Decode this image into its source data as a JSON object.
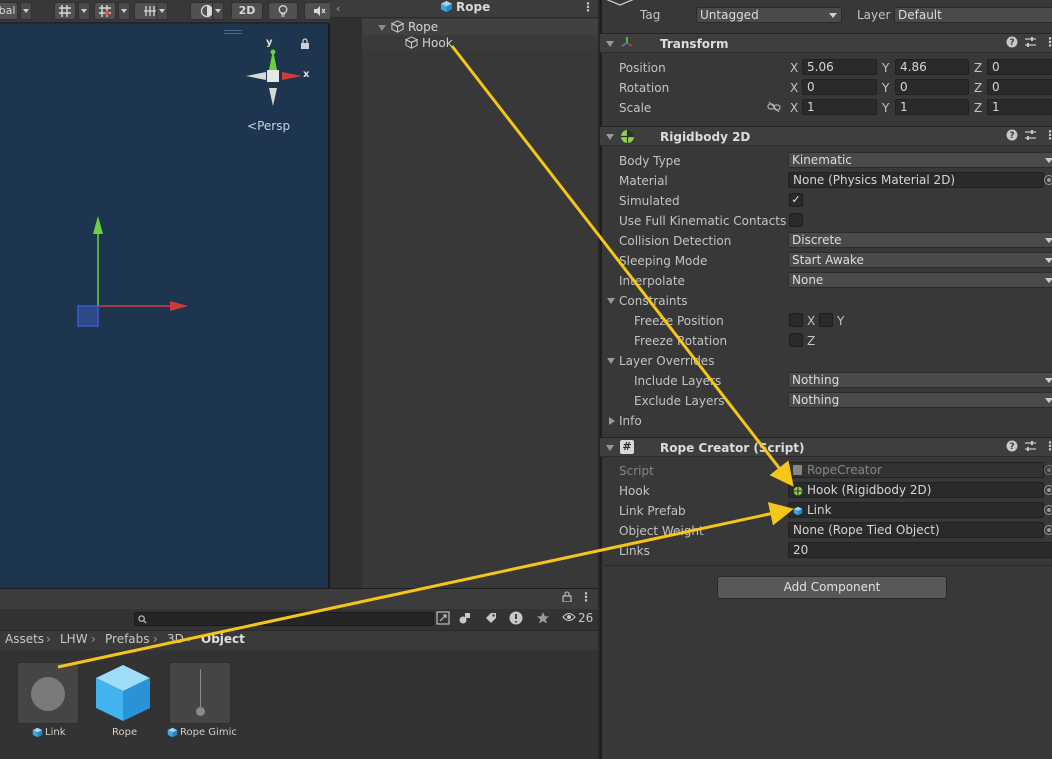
{
  "scene": {
    "toolbar": {
      "global_label": "bal",
      "mode_2d_label": "2D"
    },
    "gizmo": {
      "y_label": "y",
      "x_label": "x",
      "projection_label": "Persp"
    }
  },
  "hierarchy": {
    "title": "Rope",
    "items": [
      {
        "label": "Rope"
      },
      {
        "label": "Hook"
      }
    ]
  },
  "project": {
    "hidden_count": "26",
    "breadcrumb": [
      "Assets",
      "LHW",
      "Prefabs",
      "3D",
      "Object"
    ],
    "assets": [
      {
        "label": "Link"
      },
      {
        "label": "Rope"
      },
      {
        "label": "Rope Gimic"
      }
    ]
  },
  "inspector": {
    "tag_label": "Tag",
    "tag_value": "Untagged",
    "layer_label": "Layer",
    "layer_value": "Default",
    "transform": {
      "title": "Transform",
      "position_label": "Position",
      "rotation_label": "Rotation",
      "scale_label": "Scale",
      "position": {
        "x": "5.06",
        "y": "4.86",
        "z": "0"
      },
      "rotation": {
        "x": "0",
        "y": "0",
        "z": "0"
      },
      "scale": {
        "x": "1",
        "y": "1",
        "z": "1"
      }
    },
    "rigidbody": {
      "title": "Rigidbody 2D",
      "body_type_label": "Body Type",
      "body_type": "Kinematic",
      "material_label": "Material",
      "material": "None (Physics Material 2D)",
      "simulated_label": "Simulated",
      "simulated": "✓",
      "full_kinematic_label": "Use Full Kinematic Contacts",
      "collision_label": "Collision Detection",
      "collision": "Discrete",
      "sleeping_label": "Sleeping Mode",
      "sleeping": "Start Awake",
      "interpolate_label": "Interpolate",
      "interpolate": "None",
      "constraints_label": "Constraints",
      "freeze_position_label": "Freeze Position",
      "freeze_rotation_label": "Freeze Rotation",
      "axis_x": "X",
      "axis_y": "Y",
      "axis_z": "Z",
      "layer_overrides_label": "Layer Overrides",
      "include_layers_label": "Include Layers",
      "include_layers": "Nothing",
      "exclude_layers_label": "Exclude Layers",
      "exclude_layers": "Nothing",
      "info_label": "Info"
    },
    "rope_creator": {
      "title": "Rope Creator (Script)",
      "script_label": "Script",
      "script_value": "RopeCreator",
      "hook_label": "Hook",
      "hook_value": "Hook (Rigidbody 2D)",
      "link_prefab_label": "Link Prefab",
      "link_prefab_value": "Link",
      "object_weight_label": "Object Weight",
      "object_weight_value": "None (Rope Tied Object)",
      "links_label": "Links",
      "links_value": "20"
    },
    "add_component_label": "Add Component"
  },
  "colors": {
    "scene_bg": "#1e3550",
    "annotation_arrow": "#f5c518",
    "axis_x": "#d23a3a",
    "axis_y": "#6bd13a",
    "axis_z": "#3a5ad2"
  }
}
